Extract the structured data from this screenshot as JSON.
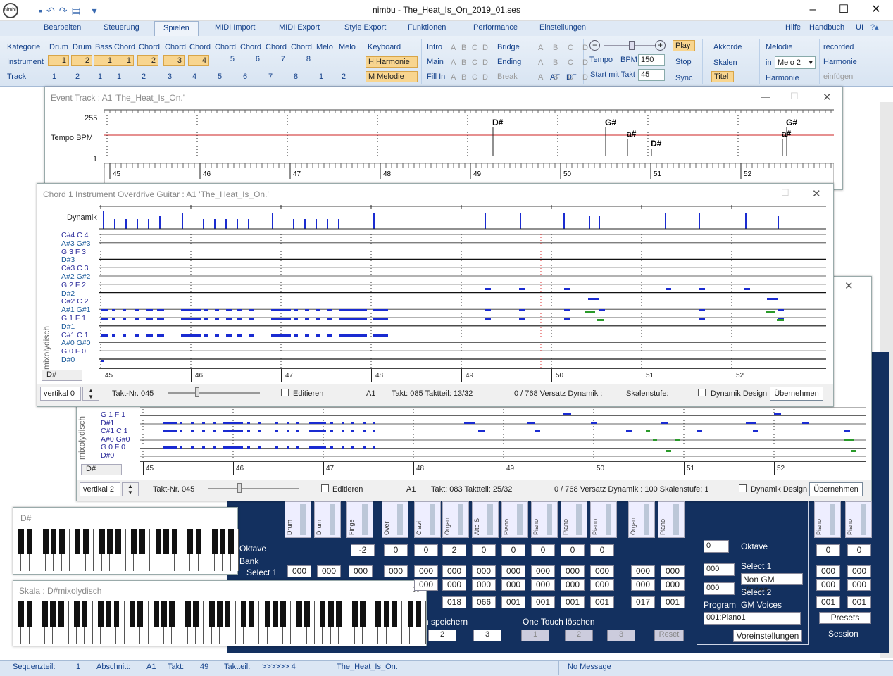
{
  "window": {
    "title": "nimbu - The_Heat_Is_On_2019_01.ses"
  },
  "menu": [
    "Bearbeiten",
    "Steuerung",
    "Spielen",
    "MIDI Import",
    "MIDI Export",
    "Style Export",
    "Funktionen",
    "Performance",
    "Einstellungen"
  ],
  "menu_right": [
    "Hilfe",
    "Handbuch",
    "UI"
  ],
  "ribbon": {
    "labels": [
      "Kategorie",
      "Instrument",
      "Track"
    ],
    "categories": [
      "Drum",
      "Drum",
      "Bass",
      "Chord",
      "Chord",
      "Chord",
      "Chord",
      "Chord",
      "Chord",
      "Chord",
      "Chord",
      "Melo",
      "Melo"
    ],
    "instrument_nums": [
      "1",
      "2",
      "1",
      "1",
      "2",
      "3",
      "4",
      "5",
      "6",
      "7",
      "8"
    ],
    "track_nums": [
      "1",
      "2",
      "1",
      "1",
      "2",
      "3",
      "4",
      "5",
      "6",
      "7",
      "8",
      "1",
      "2"
    ],
    "keyboard": {
      "title": "Keyboard",
      "harmonie": "H  Harmonie",
      "melodie": "M  Melodie"
    },
    "style": {
      "rows": [
        "Intro",
        "Main",
        "Fill In"
      ],
      "letters": [
        "A",
        "B",
        "C",
        "D"
      ],
      "bridge": "Bridge",
      "ending": "Ending",
      "break": "Break",
      "af": "AF",
      "df": "DF"
    },
    "tempo": {
      "label": "Tempo",
      "bpm_label": "BPM",
      "bpm": "150",
      "start_label": "Start mit Takt",
      "start": "45"
    },
    "transport": [
      "Play",
      "Stop",
      "Sync"
    ],
    "akkorde": [
      "Akkorde",
      "Skalen",
      "Titel"
    ],
    "melodie": {
      "title": "Melodie",
      "in": "in",
      "value": "Melo 2",
      "harmonie": "Harmonie"
    },
    "recorded": [
      "recorded",
      "Harmonie",
      "einfügen"
    ]
  },
  "event_track": {
    "title": "Event Track   :   A1  'The_Heat_Is_On.'",
    "y_top": "255",
    "y_bottom": "1",
    "label": "Tempo  BPM",
    "events": [
      "D#",
      "D#",
      "G#",
      "a#",
      "G#",
      "a#"
    ],
    "bars": [
      "45",
      "46",
      "47",
      "48",
      "49",
      "50",
      "51",
      "52"
    ]
  },
  "chord_window": {
    "title": "Chord 1 Instrument  Overdrive Guitar   :   A1  'The_Heat_Is_On.'",
    "dynamik": "Dynamik",
    "notes": [
      "C#4  C  4",
      "A#3  G#3",
      "G  3  F  3",
      "D#3",
      "C#3  C  3",
      "A#2  G#2",
      "G  2  F  2",
      "D#2",
      "C#2  C  2",
      "A#1  G#1",
      "G  1  F  1",
      "D#1",
      "C#1  C  1",
      "A#0  G#0",
      "G  0  F  0",
      "D#0"
    ],
    "scale": "mixolydisch",
    "key": "D#",
    "bars": [
      "45",
      "46",
      "47",
      "48",
      "49",
      "50",
      "51",
      "52"
    ],
    "vertical": "vertikal 0",
    "takt_label": "Takt-Nr.  045",
    "editieren": "Editieren",
    "part": "A1",
    "takt": "Takt:  085  Taktteil:  13/32",
    "versatz": "0   / 768 Versatz  Dynamik :",
    "skalen": "Skalenstufe:",
    "dyn_design": "Dynamik Design",
    "uebernehmen": "Übernehmen"
  },
  "second_window": {
    "notes": [
      "G  1  F  1",
      "D#1",
      "C#1  C  1",
      "A#0  G#0",
      "G  0  F  0",
      "D#0"
    ],
    "scale": "mixolydisch",
    "key": "D#",
    "bars": [
      "45",
      "46",
      "47",
      "48",
      "49",
      "50",
      "51",
      "52"
    ],
    "vertical": "vertikal 2",
    "takt_label": "Takt-Nr.  045",
    "editieren": "Editieren",
    "part": "A1",
    "takt": "Takt:  083  Taktteil:  25/32",
    "versatz": "0   / 768 Versatz  Dynamik :  100  Skalenstufe:  1",
    "dyn_design": "Dynamik Design",
    "uebernehmen": "Übernehmen"
  },
  "keyboard1": {
    "title": "D#"
  },
  "keyboard2": {
    "title": "Skala : D#mixolydisch"
  },
  "mixer": {
    "oktave": "Oktave",
    "bank": "Bank",
    "select1": "Select 1",
    "oktave_vals": [
      "-2",
      "0",
      "0",
      "2",
      "0",
      "0",
      "0",
      "0",
      "0",
      "0",
      "0"
    ],
    "row1": [
      "000",
      "000",
      "000",
      "000",
      "000",
      "000",
      "000",
      "000",
      "000",
      "000",
      "000",
      "000",
      "000",
      "000",
      "000"
    ],
    "row3": [
      "018",
      "066",
      "001",
      "001",
      "001",
      "001",
      "017",
      "001",
      "001",
      "001"
    ],
    "channels": [
      "Drum",
      "Drum",
      "Finge",
      "Over",
      "Clavi",
      "Organ",
      "Alto S",
      "Piano",
      "Piano",
      "Piano",
      "Piano",
      "Organ",
      "Piano",
      "Piano",
      "Piano"
    ],
    "speichern": "n speichern",
    "loeschen": "One Touch löschen",
    "buttons": [
      "2",
      "3",
      "1",
      "2",
      "3"
    ],
    "reset": "Reset",
    "right": {
      "oktave": "Oktave",
      "oktave_val": "0",
      "select1": "Select 1",
      "sel1_val": "000",
      "non_gm": "Non GM Voices",
      "select2": "Select 2",
      "sel2_val": "000",
      "program": "Program",
      "gm": "GM Voices",
      "prog_val": "001:Piano1",
      "voreinst": "Voreinstellungen",
      "presets": "Presets",
      "session": "Session"
    }
  },
  "status": {
    "sequenzteil_label": "Sequenzteil:",
    "sequenzteil": "1",
    "abschnitt_label": "Abschnitt:",
    "abschnitt": "A1",
    "takt_label": "Takt:",
    "takt": "49",
    "taktteil_label": "Taktteil:",
    "taktteil": ">>>>>> 4",
    "song": "The_Heat_Is_On.",
    "message": "No Message"
  },
  "colors": {
    "note_blue": "#1a2bd1",
    "note_green": "#2a9a2a",
    "ribbon_text": "#15428b",
    "tempo_line": "#cc2222",
    "mixer_bg": "#13305f"
  }
}
